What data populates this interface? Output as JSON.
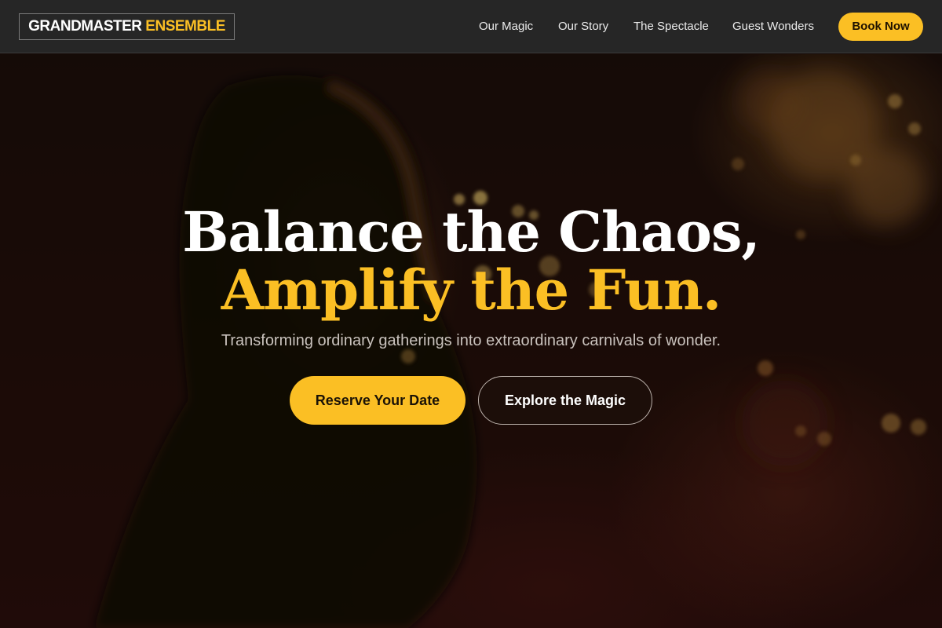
{
  "header": {
    "logo_primary": "GRANDMASTER",
    "logo_accent": "ENSEMBLE",
    "nav": [
      {
        "label": "Our Magic"
      },
      {
        "label": "Our Story"
      },
      {
        "label": "The Spectacle"
      },
      {
        "label": "Guest Wonders"
      }
    ],
    "cta_label": "Book Now"
  },
  "hero": {
    "headline_line1": "Balance the Chaos,",
    "headline_line2": "Amplify the Fun.",
    "subtitle": "Transforming ordinary gatherings into extraordinary carnivals of wonder.",
    "primary_button": "Reserve Your Date",
    "secondary_button": "Explore the Magic"
  },
  "colors": {
    "accent": "#fbbf24",
    "header_bg": "#262626",
    "hero_bg": "#1f0e09",
    "text_light": "#ffffff",
    "text_muted": "#c9c2bd"
  }
}
